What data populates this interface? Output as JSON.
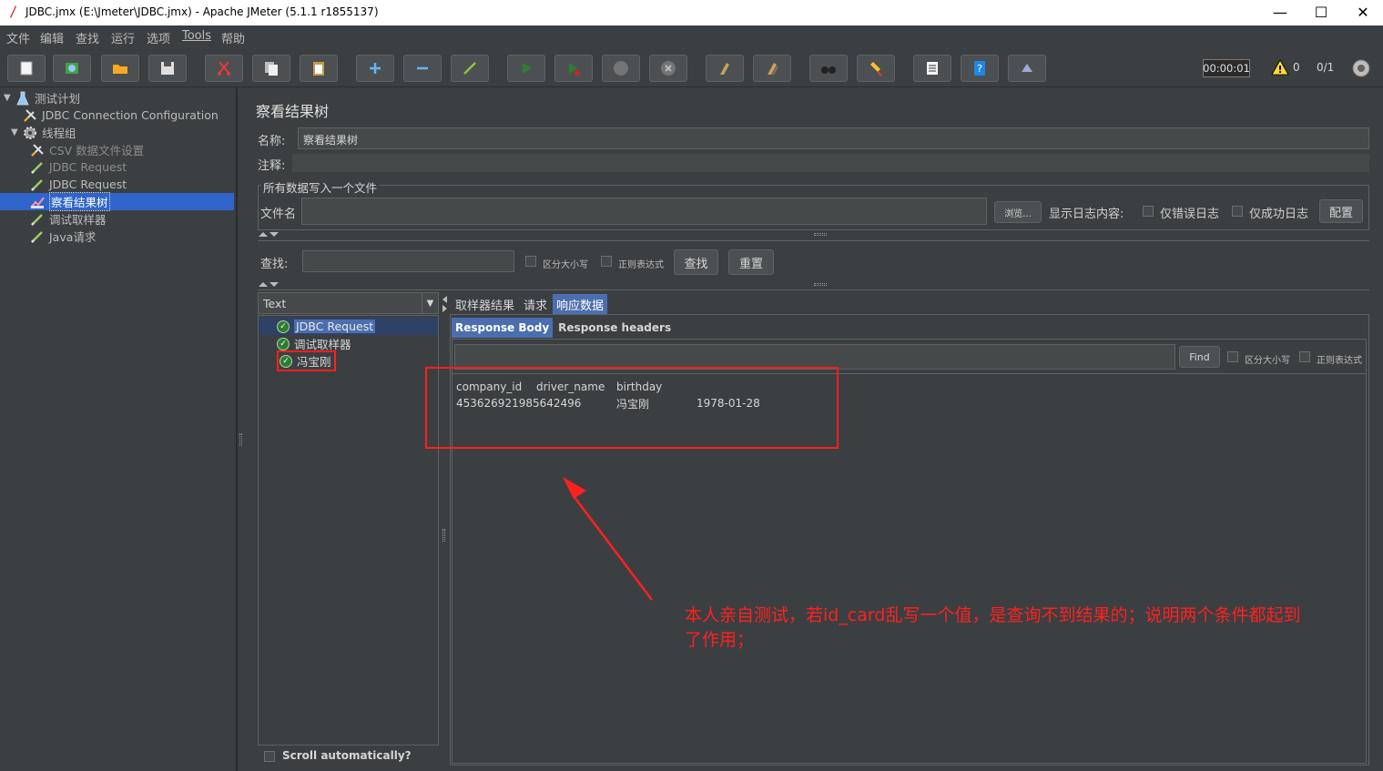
{
  "window": {
    "title": "JDBC.jmx (E:\\Jmeter\\JDBC.jmx) - Apache JMeter (5.1.1 r1855137)",
    "minimize": "—",
    "maximize": "☐",
    "close": "✕"
  },
  "menu": [
    "文件",
    "编辑",
    "查找",
    "运行",
    "选项",
    "Tools",
    "帮助"
  ],
  "status": {
    "timer": "00:00:01",
    "warnings": "0",
    "threads": "0/1"
  },
  "tree": {
    "items": [
      {
        "label": "测试计划",
        "icon": "test-plan-icon",
        "level": 0,
        "toggle": "▼"
      },
      {
        "label": "JDBC Connection Configuration",
        "icon": "config-icon",
        "level": 1
      },
      {
        "label": "线程组",
        "icon": "gear-icon",
        "level": 1,
        "toggle": "▼"
      },
      {
        "label": "CSV 数据文件设置",
        "icon": "config-icon",
        "level": 2,
        "disabled": true
      },
      {
        "label": "JDBC Request",
        "icon": "sampler-icon",
        "level": 2,
        "disabled": true
      },
      {
        "label": "JDBC Request",
        "icon": "sampler-icon",
        "level": 2
      },
      {
        "label": "察看结果树",
        "icon": "listener-icon",
        "level": 2,
        "selected": true
      },
      {
        "label": "调试取样器",
        "icon": "sampler-icon",
        "level": 2
      },
      {
        "label": "Java请求",
        "icon": "sampler-icon",
        "level": 2
      }
    ]
  },
  "panel": {
    "title": "察看结果树",
    "name_label": "名称:",
    "name_value": "察看结果树",
    "comment_label": "注释:",
    "file_section_title": "所有数据写入一个文件",
    "filename_label": "文件名",
    "browse_button": "浏览...",
    "log_label": "显示日志内容:",
    "errors_only": "仅错误日志",
    "success_only": "仅成功日志",
    "configure_button": "配置",
    "search_label": "查找:",
    "case_sensitive": "区分大小写",
    "regex": "正则表达式",
    "search_button": "查找",
    "reset_button": "重置"
  },
  "results": {
    "renderer": "Text",
    "items": [
      "JDBC Request",
      "调试取样器",
      "冯宝刚"
    ],
    "scroll_auto": "Scroll automatically?"
  },
  "tabs": {
    "main": [
      "取样器结果",
      "请求",
      "响应数据"
    ],
    "active_main": "响应数据",
    "sub": [
      "Response Body",
      "Response headers"
    ],
    "active_sub": "Response Body"
  },
  "response": {
    "find_button": "Find",
    "case_sensitive": "区分大小写",
    "regex": "正则表达式",
    "headers": [
      "company_id",
      "driver_name",
      "birthday"
    ],
    "rows": [
      [
        "453626921985642496",
        "冯宝刚",
        "1978-01-28"
      ]
    ]
  },
  "annotation": {
    "text_line1": "本人亲自测试，若id_card乱写一个值，是查询不到结果的；说明两个条件都起到",
    "text_line2": "了作用；",
    "color": "#ff2020"
  }
}
